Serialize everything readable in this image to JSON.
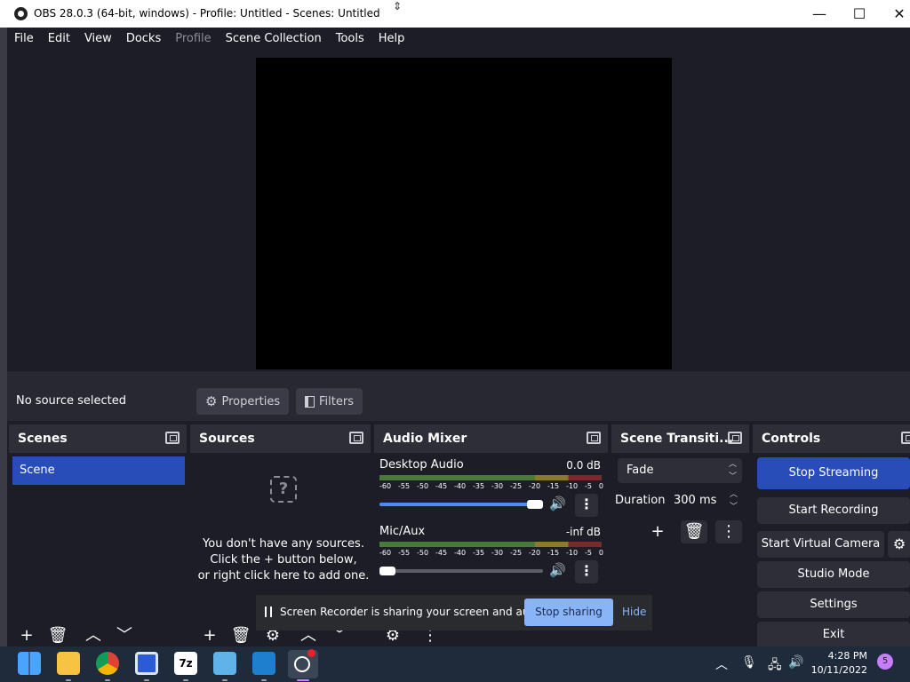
{
  "window": {
    "title": "OBS 28.0.3 (64-bit, windows) - Profile: Untitled - Scenes: Untitled",
    "minimize": "—",
    "maximize": "☐",
    "close": "✕"
  },
  "menubar": {
    "items": [
      {
        "label": "File",
        "disabled": false
      },
      {
        "label": "Edit",
        "disabled": false
      },
      {
        "label": "View",
        "disabled": false
      },
      {
        "label": "Docks",
        "disabled": false
      },
      {
        "label": "Profile",
        "disabled": true
      },
      {
        "label": "Scene Collection",
        "disabled": false
      },
      {
        "label": "Tools",
        "disabled": false
      },
      {
        "label": "Help",
        "disabled": false
      }
    ]
  },
  "context": {
    "status": "No source selected",
    "properties": "Properties",
    "filters": "Filters"
  },
  "scenes": {
    "title": "Scenes",
    "items": [
      "Scene"
    ]
  },
  "sources": {
    "title": "Sources",
    "empty_icon": "?",
    "empty_line1": "You don't have any sources.",
    "empty_line2": "Click the + button below,",
    "empty_line3": "or right click here to add one."
  },
  "mixer": {
    "title": "Audio Mixer",
    "ticks": [
      "-60",
      "-55",
      "-50",
      "-45",
      "-40",
      "-35",
      "-30",
      "-25",
      "-20",
      "-15",
      "-10",
      "-5",
      "0"
    ],
    "channels": [
      {
        "name": "Desktop Audio",
        "db": "0.0 dB",
        "volume": 1.0
      },
      {
        "name": "Mic/Aux",
        "db": "-inf dB",
        "volume": 0.0
      }
    ]
  },
  "transitions": {
    "title": "Scene Transiti...",
    "selected": "Fade",
    "duration_label": "Duration",
    "duration_value": "300 ms"
  },
  "controls": {
    "title": "Controls",
    "stop_streaming": "Stop Streaming",
    "start_recording": "Start Recording",
    "start_virtual_camera": "Start Virtual Camera",
    "studio_mode": "Studio Mode",
    "settings": "Settings",
    "exit": "Exit"
  },
  "share": {
    "message": "Screen Recorder is sharing your screen and audio.",
    "stop": "Stop sharing",
    "hide": "Hide"
  },
  "taskbar": {
    "time": "4:28 PM",
    "date": "10/11/2022",
    "notifications": "5"
  },
  "colors": {
    "accent": "#284cb8",
    "panel": "#272832",
    "background": "#1c1d26",
    "share_button": "#8ab4f8"
  }
}
